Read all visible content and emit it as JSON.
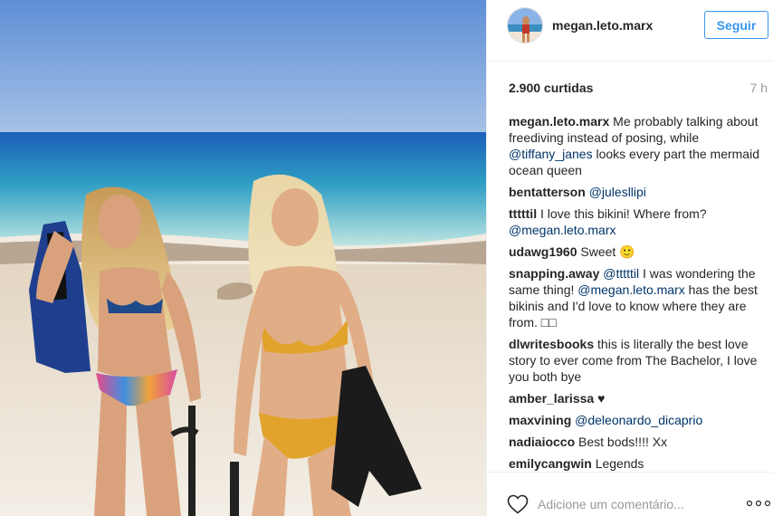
{
  "post": {
    "username": "megan.leto.marx",
    "follow_label": "Seguir",
    "likes": "2.900 curtidas",
    "time": "7 h",
    "add_comment_placeholder": "Adicione um comentário...",
    "comments": [
      {
        "user": "megan.leto.marx",
        "parts": [
          {
            "t": "Me probably talking about freediving instead of posing, while "
          },
          {
            "t": "@tiffany_janes",
            "mention": true
          },
          {
            "t": " looks every part the mermaid ocean queen"
          }
        ]
      },
      {
        "user": "bentatterson",
        "parts": [
          {
            "t": "@julesllipi",
            "mention": true
          }
        ]
      },
      {
        "user": "tttttil",
        "parts": [
          {
            "t": "I love this bikini! Where from? "
          },
          {
            "t": "@megan.leto.marx",
            "mention": true
          }
        ]
      },
      {
        "user": "udawg1960",
        "parts": [
          {
            "t": "Sweet 🙂"
          }
        ]
      },
      {
        "user": "snapping.away",
        "parts": [
          {
            "t": "@tttttil",
            "mention": true
          },
          {
            "t": " I was wondering the same thing! "
          },
          {
            "t": "@megan.leto.marx",
            "mention": true
          },
          {
            "t": " has the best bikinis and I'd love to know where they are from. □□"
          }
        ]
      },
      {
        "user": "dlwritesbooks",
        "parts": [
          {
            "t": "this is literally the best love story to ever come from The Bachelor, I love you both bye"
          }
        ]
      },
      {
        "user": "amber_larissa",
        "parts": [
          {
            "t": "♥"
          }
        ]
      },
      {
        "user": "maxvining",
        "parts": [
          {
            "t": "@deleonardo_dicaprio",
            "mention": true
          }
        ]
      },
      {
        "user": "nadiaiocco",
        "parts": [
          {
            "t": "Best bods!!!! Xx"
          }
        ]
      },
      {
        "user": "emilycangwin",
        "parts": [
          {
            "t": "Legends"
          }
        ]
      }
    ]
  },
  "icons": {
    "like": "heart-outline-icon",
    "more": "more-options-icon"
  },
  "colors": {
    "accent": "#3897f0",
    "mention": "#003569",
    "text": "#262626",
    "muted": "#999999",
    "border": "#efefef"
  }
}
